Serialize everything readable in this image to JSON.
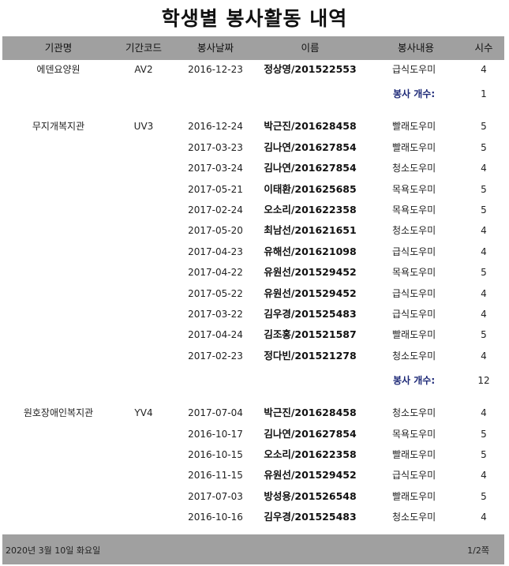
{
  "title": "학생별 봉사활동 내역",
  "columns": [
    "기관명",
    "기간코드",
    "봉사날짜",
    "이름",
    "봉사내용",
    "시수"
  ],
  "count_label": "봉사 개수:",
  "groups": [
    {
      "institution": "에덴요양원",
      "code": "AV2",
      "count": "1",
      "rows": [
        {
          "date": "2016-12-23",
          "name": "정상영/201522553",
          "task": "급식도우미",
          "hours": "4"
        }
      ]
    },
    {
      "institution": "무지개복지관",
      "code": "UV3",
      "count": "12",
      "rows": [
        {
          "date": "2016-12-24",
          "name": "박근진/201628458",
          "task": "빨래도우미",
          "hours": "5"
        },
        {
          "date": "2017-03-23",
          "name": "김나연/201627854",
          "task": "빨래도우미",
          "hours": "5"
        },
        {
          "date": "2017-03-24",
          "name": "김나연/201627854",
          "task": "청소도우미",
          "hours": "4"
        },
        {
          "date": "2017-05-21",
          "name": "이태환/201625685",
          "task": "목욕도우미",
          "hours": "5"
        },
        {
          "date": "2017-02-24",
          "name": "오소리/201622358",
          "task": "목욕도우미",
          "hours": "5"
        },
        {
          "date": "2017-05-20",
          "name": "최남선/201621651",
          "task": "청소도우미",
          "hours": "4"
        },
        {
          "date": "2017-04-23",
          "name": "유해선/201621098",
          "task": "급식도우미",
          "hours": "4"
        },
        {
          "date": "2017-04-22",
          "name": "유원선/201529452",
          "task": "목욕도우미",
          "hours": "5"
        },
        {
          "date": "2017-05-22",
          "name": "유원선/201529452",
          "task": "급식도우미",
          "hours": "4"
        },
        {
          "date": "2017-03-22",
          "name": "김우경/201525483",
          "task": "급식도우미",
          "hours": "4"
        },
        {
          "date": "2017-04-24",
          "name": "김조홍/201521587",
          "task": "빨래도우미",
          "hours": "5"
        },
        {
          "date": "2017-02-23",
          "name": "정다빈/201521278",
          "task": "청소도우미",
          "hours": "4"
        }
      ]
    },
    {
      "institution": "원호장애인복지관",
      "code": "YV4",
      "count": null,
      "rows": [
        {
          "date": "2017-07-04",
          "name": "박근진/201628458",
          "task": "청소도우미",
          "hours": "4"
        },
        {
          "date": "2016-10-17",
          "name": "김나연/201627854",
          "task": "목욕도우미",
          "hours": "5"
        },
        {
          "date": "2016-10-15",
          "name": "오소리/201622358",
          "task": "빨래도우미",
          "hours": "5"
        },
        {
          "date": "2016-11-15",
          "name": "유원선/201529452",
          "task": "급식도우미",
          "hours": "4"
        },
        {
          "date": "2017-07-03",
          "name": "방성용/201526548",
          "task": "빨래도우미",
          "hours": "5"
        },
        {
          "date": "2016-10-16",
          "name": "김우경/201525483",
          "task": "청소도우미",
          "hours": "4"
        }
      ]
    }
  ],
  "footer": {
    "date": "2020년 3월 10일 화요일",
    "page": "1/2쪽"
  }
}
